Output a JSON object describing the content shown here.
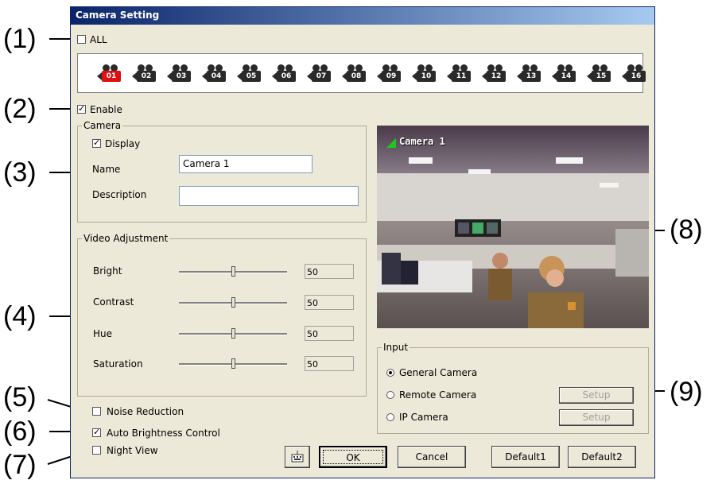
{
  "callouts": [
    "(1)",
    "(2)",
    "(3)",
    "(4)",
    "(5)",
    "(6)",
    "(7)",
    "(8)",
    "(9)"
  ],
  "window": {
    "title": "Camera Setting"
  },
  "all_label": "ALL",
  "cameras": [
    "01",
    "02",
    "03",
    "04",
    "05",
    "06",
    "07",
    "08",
    "09",
    "10",
    "11",
    "12",
    "13",
    "14",
    "15",
    "16"
  ],
  "selected_camera": "01",
  "enable": {
    "label": "Enable",
    "checked": true
  },
  "camera_group": {
    "title": "Camera",
    "display_label": "Display",
    "name_label": "Name",
    "name_value": "Camera 1",
    "description_label": "Description",
    "description_value": ""
  },
  "video_adjustment": {
    "title": "Video Adjustment",
    "sliders": [
      {
        "label": "Bright",
        "value": "50"
      },
      {
        "label": "Contrast",
        "value": "50"
      },
      {
        "label": "Hue",
        "value": "50"
      },
      {
        "label": "Saturation",
        "value": "50"
      }
    ]
  },
  "options": {
    "noise_reduction": {
      "label": "Noise Reduction",
      "checked": false
    },
    "auto_brightness": {
      "label": "Auto Brightness Control",
      "checked": true
    },
    "night_view": {
      "label": "Night View",
      "checked": false
    }
  },
  "preview": {
    "overlay_label": "Camera 1"
  },
  "input_group": {
    "title": "Input",
    "options": [
      "General Camera",
      "Remote Camera",
      "IP Camera"
    ],
    "selected": "General Camera",
    "setup_label": "Setup"
  },
  "buttons": {
    "ok": "OK",
    "cancel": "Cancel",
    "default1": "Default1",
    "default2": "Default2"
  },
  "colors": {
    "title_bar": "#0a246a",
    "selected_camera": "#e01010",
    "dialog_bg": "#ece9d8"
  }
}
